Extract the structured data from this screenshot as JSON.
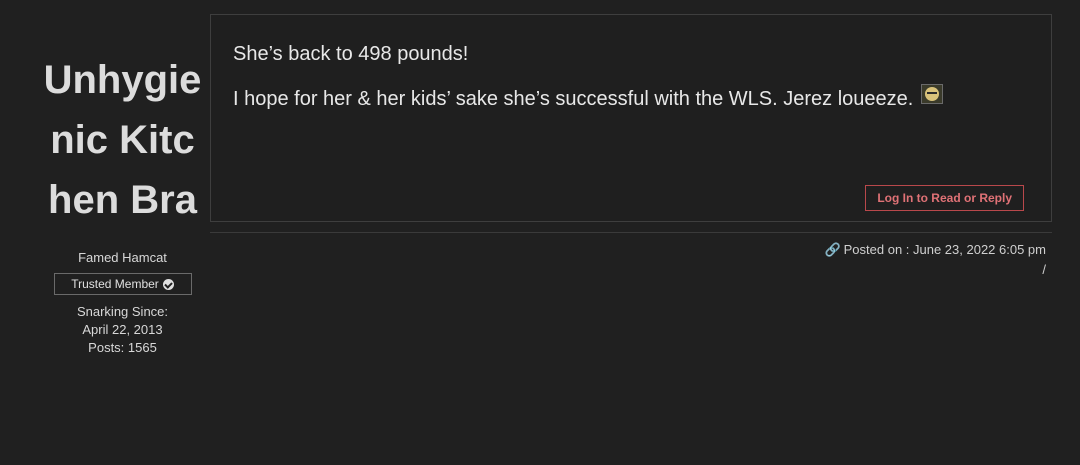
{
  "author": {
    "name": "Unhygienic Kitchen Bra",
    "rank": "Famed Hamcat",
    "badge_label": "Trusted Member",
    "snarking_since_label": "Snarking Since:",
    "snarking_since_date": "April 22, 2013",
    "posts": "Posts: 1565"
  },
  "post": {
    "line1": "She’s back to 498 pounds!",
    "line2": "I hope for her & her kids’ sake she’s successful with the WLS. Jerez loueeze.",
    "emoji_icon": "sunglasses-smiley-icon",
    "reply_button": "Log In to Read or Reply",
    "posted_on": "Posted on : June 23, 2022 6:05 pm",
    "slash": "/"
  },
  "colors": {
    "background": "#202020",
    "accent": "#d9676b",
    "border": "#3e3e3e"
  }
}
